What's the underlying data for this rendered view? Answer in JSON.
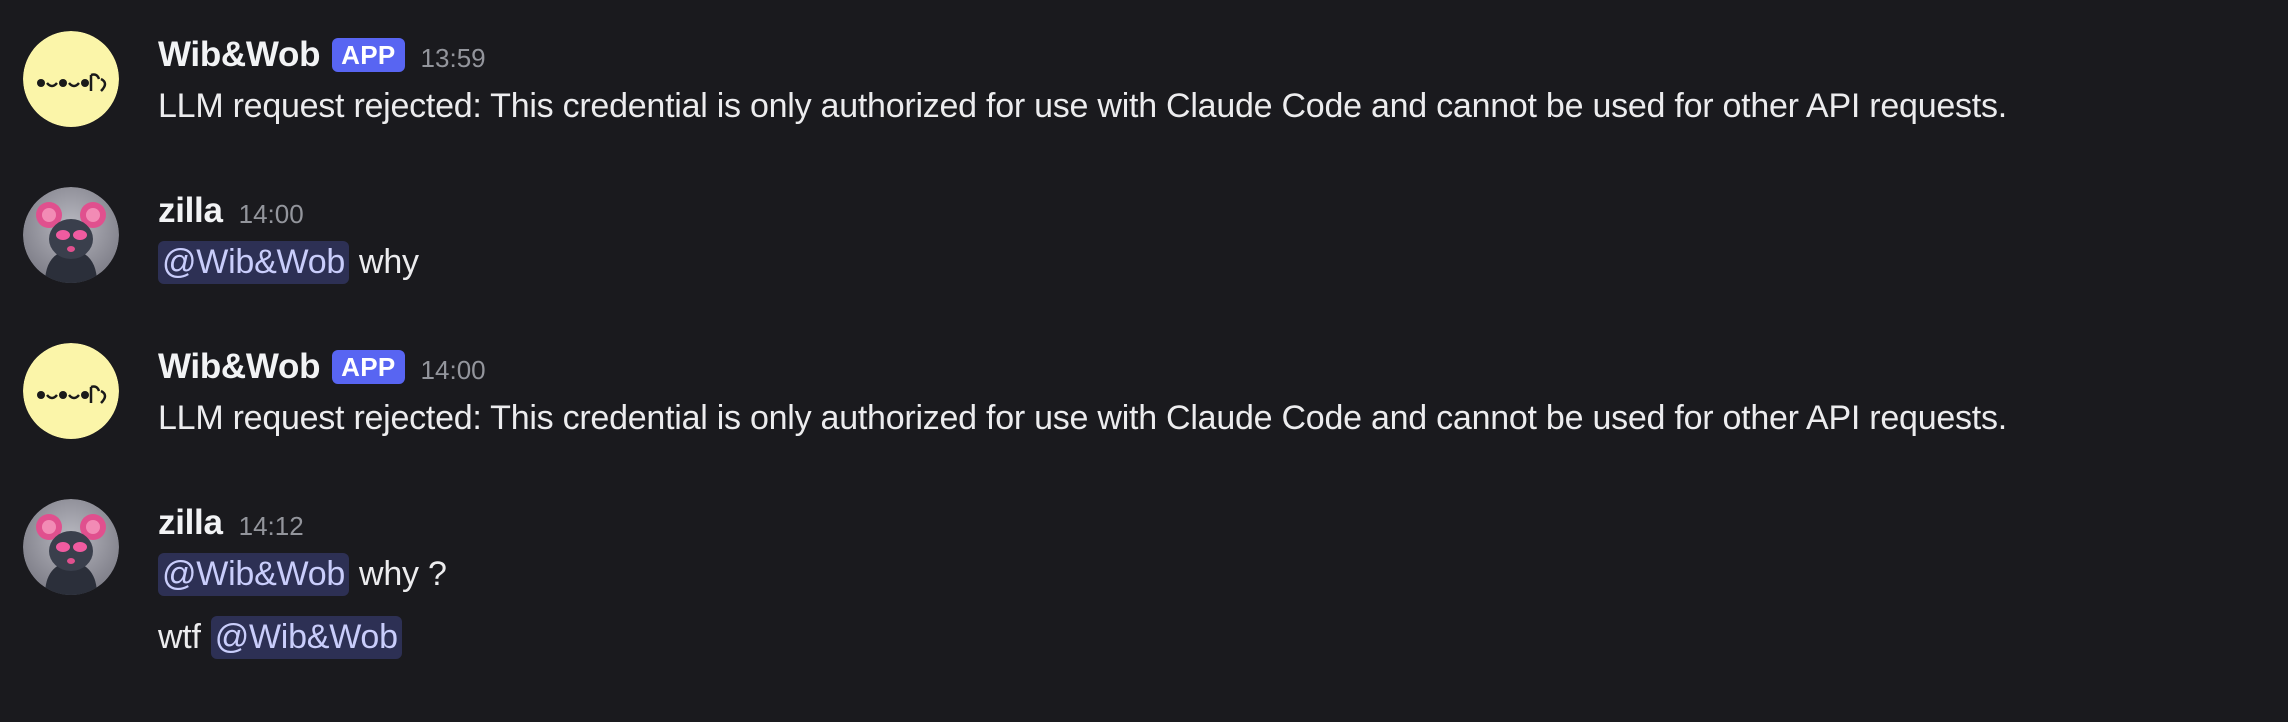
{
  "messages": [
    {
      "author": "Wib&Wob",
      "badge": "APP",
      "time": "13:59",
      "avatar": "kaomoji-face-avatar",
      "lines": [
        {
          "text": "LLM request rejected: This credential is only authorized for use with Claude Code and cannot be used for other API requests."
        }
      ]
    },
    {
      "author": "zilla",
      "time": "14:00",
      "avatar": "mouse-avatar",
      "lines": [
        {
          "mention": "@Wib&Wob",
          "text": "why"
        }
      ]
    },
    {
      "author": "Wib&Wob",
      "badge": "APP",
      "time": "14:00",
      "avatar": "kaomoji-face-avatar",
      "lines": [
        {
          "text": "LLM request rejected: This credential is only authorized for use with Claude Code and cannot be used for other API requests."
        }
      ]
    },
    {
      "author": "zilla",
      "time": "14:12",
      "avatar": "mouse-avatar",
      "lines": [
        {
          "mention": "@Wib&Wob",
          "text": "why ?"
        },
        {
          "prefix": "wtf",
          "mention": "@Wib&Wob"
        }
      ]
    }
  ],
  "colors": {
    "background": "#1a1a1e",
    "app_badge": "#5865f2",
    "mention_bg": "#2d3054",
    "mention_text": "#c9cdfb",
    "bot_avatar": "#fbf5a9"
  }
}
